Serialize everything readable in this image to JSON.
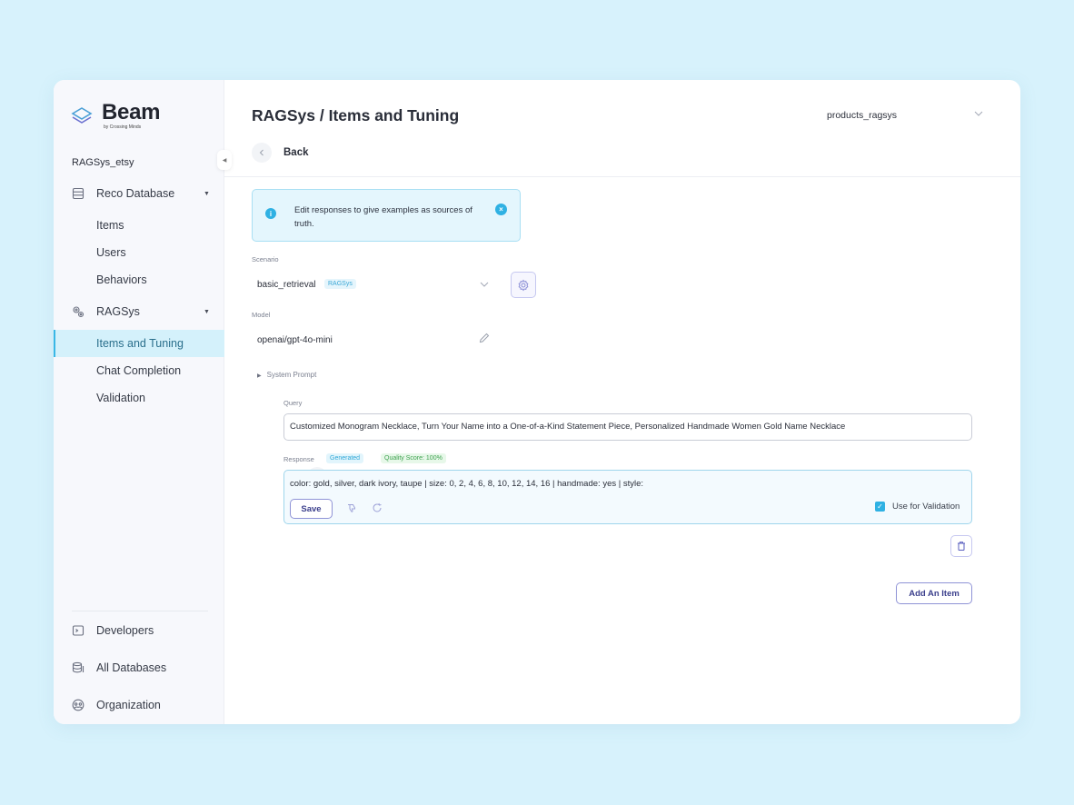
{
  "brand": {
    "name": "Beam",
    "sub": "by Crossing Minds"
  },
  "sidebar": {
    "project": "RAGSys_etsy",
    "items": [
      {
        "label": "Reco Database",
        "icon": "database-icon"
      },
      {
        "label": "Items"
      },
      {
        "label": "Users"
      },
      {
        "label": "Behaviors"
      },
      {
        "label": "RAGSys",
        "icon": "gears-icon"
      },
      {
        "label": "Items and Tuning",
        "active": true
      },
      {
        "label": "Chat Completion"
      },
      {
        "label": "Validation"
      }
    ],
    "bottom": [
      {
        "label": "Developers",
        "icon": "terminal-icon"
      },
      {
        "label": "All Databases",
        "icon": "databases-icon"
      },
      {
        "label": "Organization",
        "icon": "organization-icon"
      }
    ]
  },
  "header": {
    "title": "RAGSys / Items and Tuning",
    "database": "products_ragsys",
    "back": "Back"
  },
  "info": {
    "text": "Edit responses to give examples as sources of truth."
  },
  "scenario": {
    "label": "Scenario",
    "value": "basic_retrieval",
    "tag": "RAGSys"
  },
  "model": {
    "label": "Model",
    "value": "openai/gpt-4o-mini"
  },
  "system_prompt": {
    "label": "System Prompt"
  },
  "item": {
    "query_label": "Query",
    "query": "Customized Monogram Necklace, Turn Your Name into a One-of-a-Kind Statement Piece, Personalized Handmade Women Gold Name Necklace",
    "response_label": "Response",
    "response_tag": "Generated",
    "quality": "Quality Score: 100%",
    "response": "color: gold, silver, dark ivory, taupe | size: 0, 2, 4, 6, 8, 10, 12, 14, 16 | handmade: yes | style:",
    "save": "Save",
    "use_validation": "Use for Validation"
  },
  "actions": {
    "add_item": "Add An Item"
  },
  "colors": {
    "accent": "#2fb1e3",
    "brand_button": "#3b3f8c",
    "active_bg": "#d4f1fb"
  }
}
